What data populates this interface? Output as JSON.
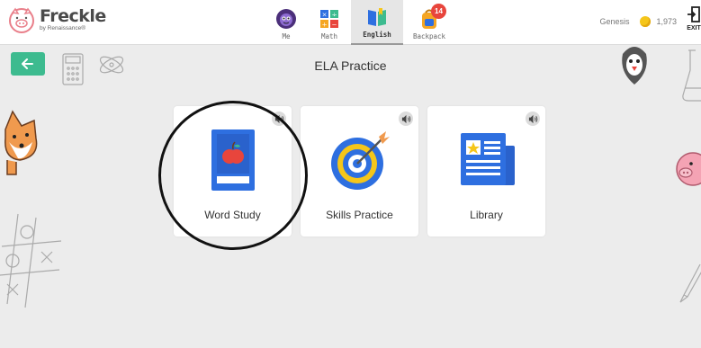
{
  "brand": {
    "name": "Freckle",
    "subtitle": "by Renaissance®"
  },
  "nav": [
    {
      "label": "Me",
      "icon": "avatar-icon",
      "active": false
    },
    {
      "label": "Math",
      "icon": "math-icon",
      "active": false
    },
    {
      "label": "English",
      "icon": "book-icon",
      "active": true
    },
    {
      "label": "Backpack",
      "icon": "backpack-icon",
      "active": false,
      "badge": "14"
    }
  ],
  "user": {
    "name": "Genesis",
    "coins": "1,973"
  },
  "exit_label": "EXIT",
  "page_title": "ELA Practice",
  "cards": [
    {
      "label": "Word Study",
      "icon": "apple-book-icon"
    },
    {
      "label": "Skills Practice",
      "icon": "target-icon"
    },
    {
      "label": "Library",
      "icon": "newspaper-icon"
    }
  ],
  "colors": {
    "accent": "#3dbb8f",
    "primary_blue": "#2e6fe0",
    "badge": "#e8453c",
    "coin": "#f5c61a"
  }
}
